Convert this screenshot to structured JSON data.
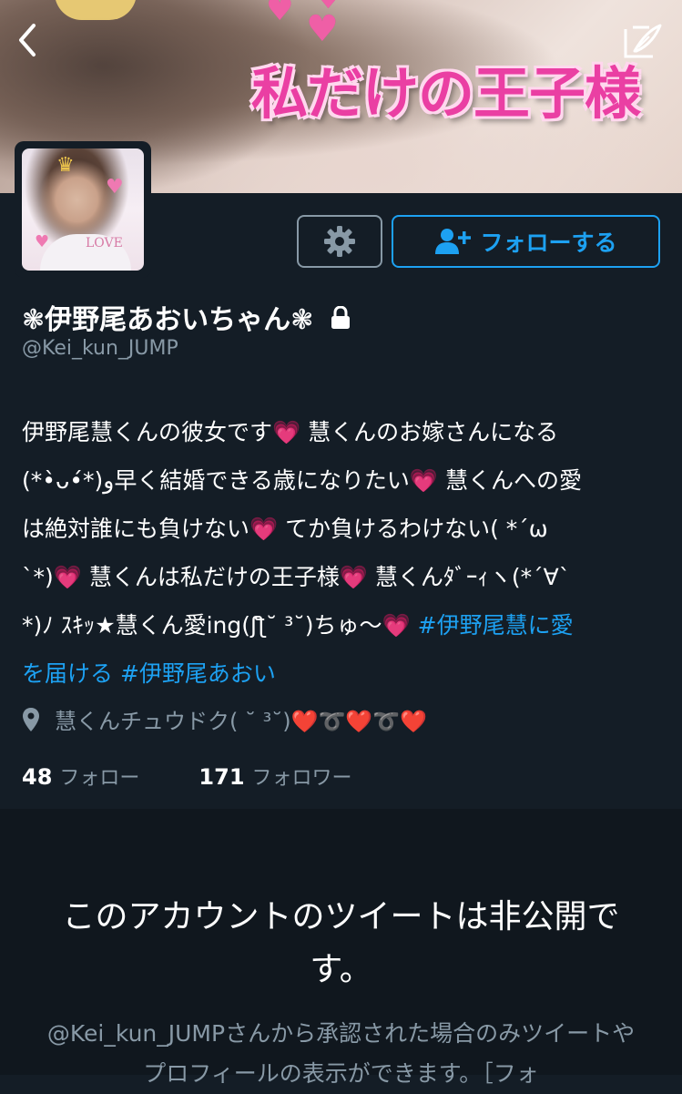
{
  "header": {
    "back_icon": "chevron-left-icon",
    "compose_icon": "compose-quill-icon",
    "banner_text": "私だけの王子様"
  },
  "profile": {
    "display_name": "❃伊野尾あおいちゃん❃",
    "handle": "@Kei_kun_JUMP",
    "protected_icon": "lock-icon",
    "settings_icon": "gear-icon",
    "follow_label": "フォローする",
    "follow_icon": "add-person-icon",
    "bio": {
      "line1": "伊野尾慧くんの彼女です💗 慧くんのお嫁さんになる",
      "line2": "(*•̀ᴗ•́*)و早く結婚できる歳になりたい💗 慧くんへの愛",
      "line3": "は絶対誰にも負けない💗 てか負けるわけない( *´ω",
      "line4": "`*)💗 慧くんは私だけの王子様💗 慧くんﾀﾞｰｨヽ(*´∀`",
      "line5_text": "*)ﾉ ｽｷｯ★慧くん愛ing(ʃƪ˘ ³˘)ちゅ～💗 ",
      "hashtag1_part1": "#伊野尾慧に愛",
      "hashtag1_part2": "を届ける",
      "hashtag2": "#伊野尾あおい"
    },
    "location": "慧くんチュウドク( ˘ ³˘)❤️➰❤️➰❤️",
    "location_icon": "location-pin-icon",
    "following_count": "48",
    "following_label": "フォロー",
    "followers_count": "171",
    "followers_label": "フォロワー"
  },
  "protected_notice": {
    "title": "このアカウントのツイートは非公開です。",
    "description": "@Kei_kun_JUMPさんから承認された場合のみツイートやプロフィールの表示ができます。［フォ"
  },
  "colors": {
    "background": "#141d26",
    "accent": "#1da1f2",
    "muted": "#8899a6"
  }
}
